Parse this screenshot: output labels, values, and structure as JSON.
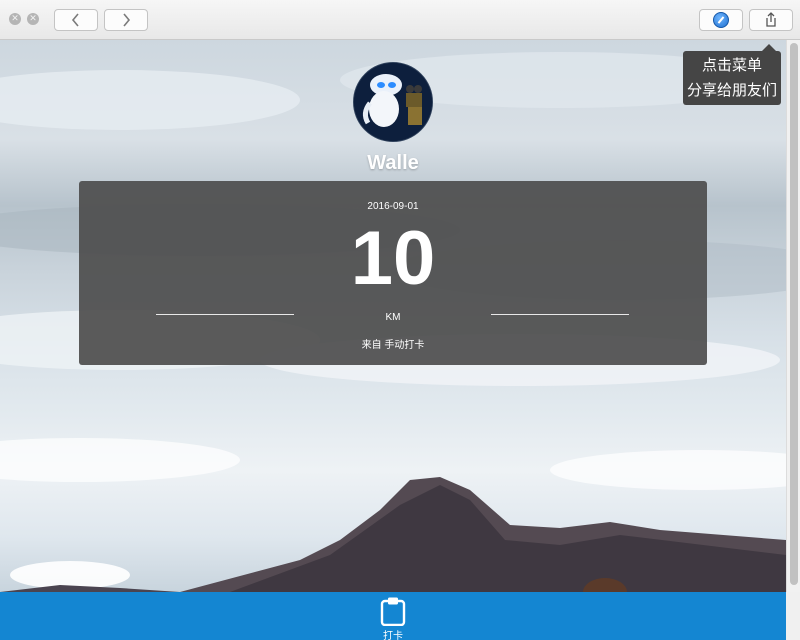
{
  "toolbar": {
    "close_glyph": "✕",
    "minimize_glyph": "✕",
    "back_icon": "chevron-left-icon",
    "forward_icon": "chevron-right-icon",
    "compass_icon": "compass-icon",
    "share_icon": "share-icon"
  },
  "tooltip": {
    "line1": "点击菜单",
    "line2": "分享给朋友们"
  },
  "profile": {
    "name": "Walle"
  },
  "record": {
    "date": "2016-09-01",
    "distance": "10",
    "unit": "KM",
    "source": "来自 手动打卡"
  },
  "bottom_nav": {
    "punch_label": "打卡",
    "punch_icon": "clipboard-icon"
  },
  "colors": {
    "accent": "#1486d2",
    "card_bg": "#4d4d4d",
    "tooltip_bg": "#454545"
  }
}
